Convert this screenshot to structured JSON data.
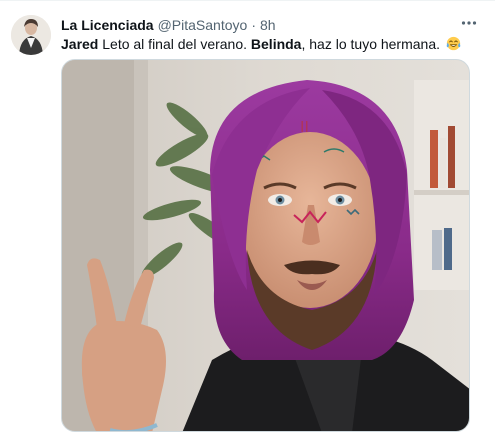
{
  "author": {
    "display_name": "La Licenciada",
    "handle": "@PitaSantoyo",
    "separator": "·",
    "time": "8h"
  },
  "tweet": {
    "name_1": "Jared",
    "text_1": " Leto al final del verano. ",
    "name_2": "Belinda",
    "text_2": ", haz lo tuyo hermana. ",
    "emoji": "face-with-tears-of-joy"
  },
  "icons": {
    "more": "more-horizontal-icon"
  },
  "colors": {
    "text_primary": "#0f1419",
    "text_secondary": "#536471",
    "hair_purple": "#8e2a8c"
  }
}
